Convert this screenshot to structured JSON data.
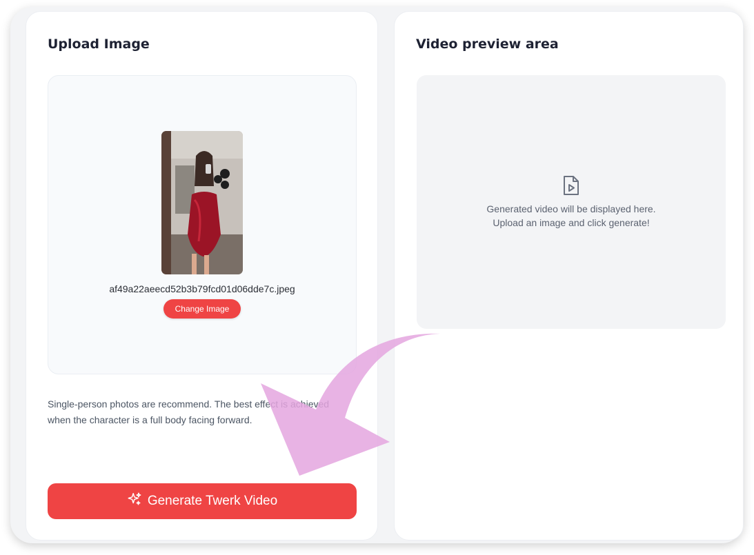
{
  "upload_panel": {
    "title": "Upload Image",
    "filename": "af49a22aeecd52b3b79fcd01d06dde7c.jpeg",
    "change_button": "Change Image",
    "hint_line1": "Single-person photos are recommend. The best effect is achieved",
    "hint_line2": "when the character is a full body facing forward.",
    "generate_button": "Generate Twerk Video",
    "generate_icon": "sparkles-icon"
  },
  "preview_panel": {
    "title": "Video preview area",
    "icon": "video-file-icon",
    "message_line1": "Generated video will be displayed here.",
    "message_line2": "Upload an image and click generate!"
  },
  "colors": {
    "accent": "#ef4444",
    "annotation_arrow": "#e4a6df"
  }
}
